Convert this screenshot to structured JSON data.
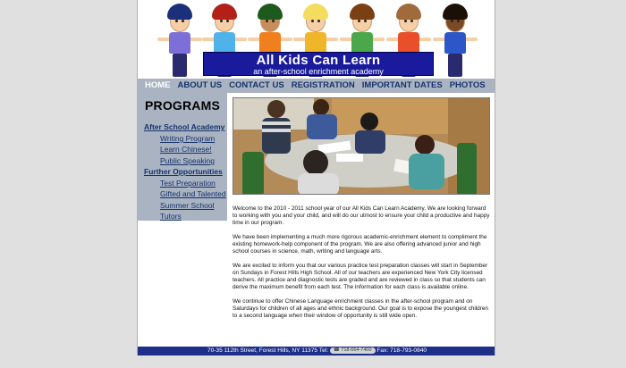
{
  "header": {
    "title": "All Kids Can Learn",
    "subtitle": "an after-school enrichment academy"
  },
  "nav": [
    {
      "label": "HOME",
      "active": true
    },
    {
      "label": "ABOUT US"
    },
    {
      "label": "CONTACT US"
    },
    {
      "label": "REGISTRATION"
    },
    {
      "label": "IMPORTANT DATES"
    },
    {
      "label": "PHOTOS"
    }
  ],
  "sidebar": {
    "title": "PROGRAMS",
    "sections": [
      {
        "heading": "After School Academy",
        "items": [
          "Writing Program",
          "Learn Chinese!",
          "Public Speaking"
        ]
      },
      {
        "heading": "Further Opportunities",
        "items": [
          "Test Preparation",
          "Gifted and Talented",
          "Summer School",
          "Tutors"
        ]
      }
    ]
  },
  "content": {
    "paragraphs": [
      "Welcome to the 2010 - 2011 school year of our All Kids Can Learn Academy. We are looking forward to working with you and your child, and will do our utmost to ensure your child a productive and happy time in our program.",
      "We have been implementing a much more rigorous academic-enrichment element to compliment the existing homework-help component of the program. We are also offering advanced junior and high school courses in science, math, writing and language arts.",
      "We are excited to inform you that our various practice test preparation classes will start in September on Sundays in Forest Hills High School. All of our teachers are experienced New York City licensed teachers. All practice and diagnostic tests are graded and are reviewed in class so that students can derive the maximum benefit from each test. The information for each class is available online.",
      "We continue to offer Chinese Language enrichment classes in the after-school program and on Saturdays for children of all ages and ethnic background. Our goal is to expose the youngest children to a second language when their window of opportunity is still wide open."
    ]
  },
  "footer": {
    "address": "70-35 112th Street, Forest Hills, NY 11375 Tel:",
    "phone": "718-664-7400",
    "fax": "Fax: 718-793-0840"
  },
  "colors": {
    "nav_bg": "#a9b3c2",
    "nav_text": "#17336b",
    "title_bg": "#1a1a9c",
    "footer_bg": "#1d2f88"
  }
}
